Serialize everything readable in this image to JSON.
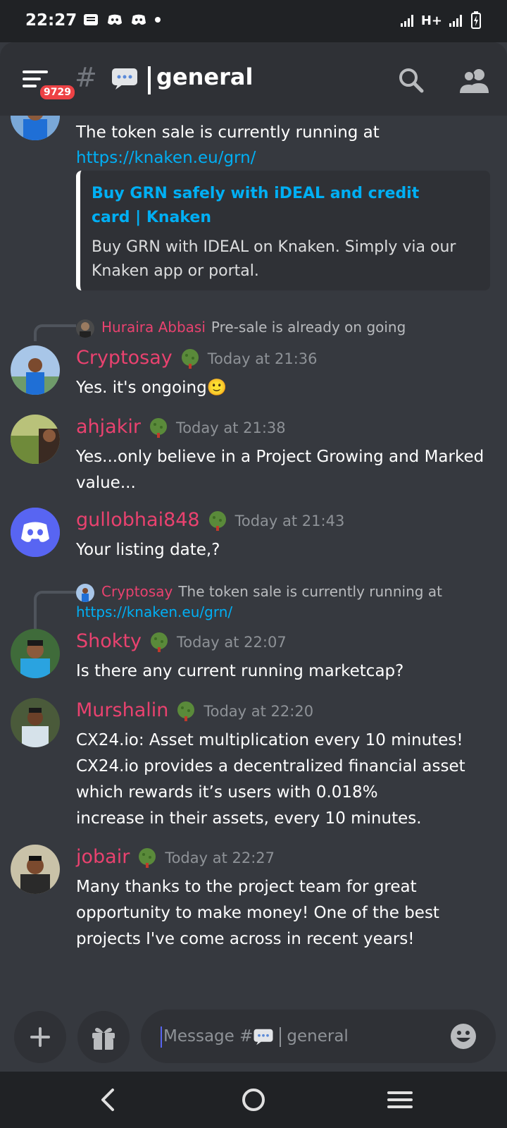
{
  "status_bar": {
    "time": "22:27",
    "network": "H+"
  },
  "header": {
    "channel_name": "general",
    "badge": "9729"
  },
  "messages": [
    {
      "text_lines": [
        "The token sale is currently running at"
      ],
      "link": "https://knaken.eu/grn/",
      "embed": {
        "title": "Buy GRN safely with iDEAL and credit card | Knaken",
        "description": "Buy GRN with IDEAL on Knaken. Simply via our Knaken app or portal."
      }
    },
    {
      "reply": {
        "author": "Huraira Abbasi",
        "text": "Pre-sale is already on going"
      },
      "author": "Cryptosay",
      "timestamp": "Today at 21:36",
      "text": "Yes. it's ongoing🙂"
    },
    {
      "author": "ahjakir",
      "timestamp": "Today at 21:38",
      "text": "Yes...only believe in a Project Growing and Marked value..."
    },
    {
      "author": "gullobhai848",
      "timestamp": "Today at 21:43",
      "text": "Your listing date,?"
    },
    {
      "reply": {
        "author": "Cryptosay",
        "text": "The token sale is currently running at",
        "link": "https://knaken.eu/grn/"
      },
      "author": "Shokty",
      "timestamp": "Today at 22:07",
      "text": "Is there any current running marketcap?"
    },
    {
      "author": "Murshalin",
      "timestamp": "Today at 22:20",
      "text_lines": [
        "CX24.io: Asset multiplication every 10 minutes!",
        "CX24.io provides a decentralized financial asset which rewards it’s users with 0.018%",
        "increase in their assets, every 10 minutes."
      ]
    },
    {
      "author": "jobair",
      "timestamp": "Today at 22:27",
      "text": "Many thanks to the project team for great opportunity to make money! One of the best projects I've come across in recent years!"
    }
  ],
  "input": {
    "placeholder_prefix": "Message #",
    "placeholder_channel": "general"
  },
  "colors": {
    "background": "#36393f",
    "header": "#2f3136",
    "username": "#e9426f",
    "link": "#00aff4",
    "blurple": "#5865f2"
  }
}
